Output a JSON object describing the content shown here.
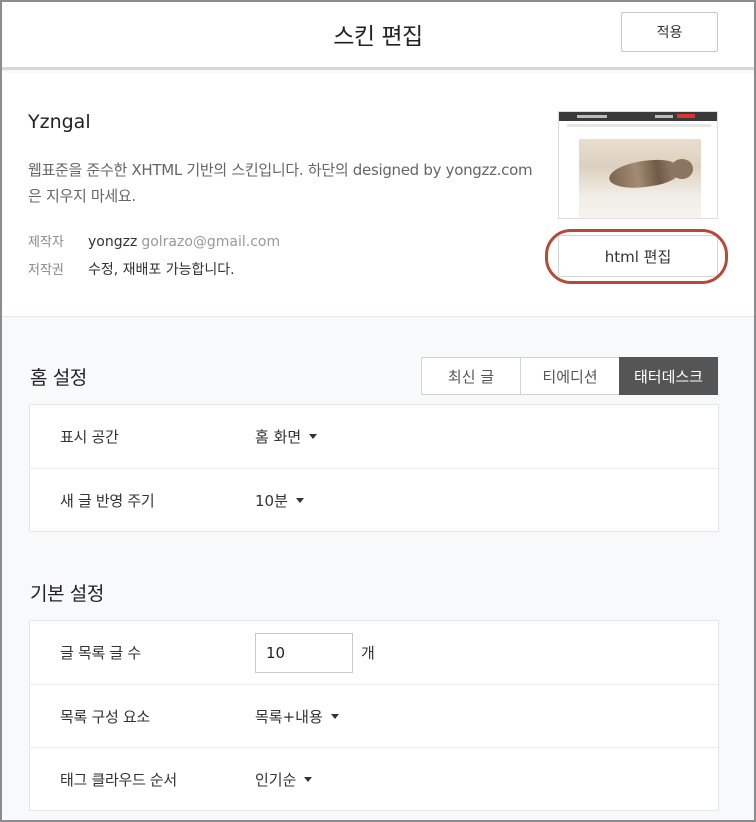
{
  "header": {
    "title": "스킨 편집",
    "apply_label": "적용"
  },
  "skin": {
    "name": "Yzngal",
    "description": "웹표준을 준수한 XHTML 기반의 스킨입니다. 하단의 designed by yongzz.com 은 지우지 마세요.",
    "author_label": "제작자",
    "author": "yongzz",
    "email": "golrazo@gmail.com",
    "copyright_label": "저작권",
    "copyright": "수정, 재배포 가능합니다.",
    "html_edit_label": "html 편집"
  },
  "home_settings": {
    "title": "홈 설정",
    "tabs": [
      {
        "label": "최신 글",
        "active": false
      },
      {
        "label": "티에디션",
        "active": false
      },
      {
        "label": "태터데스크",
        "active": true
      }
    ],
    "rows": [
      {
        "label": "표시 공간",
        "value": "홈 화면"
      },
      {
        "label": "새 글 반영 주기",
        "value": "10분"
      }
    ]
  },
  "basic_settings": {
    "title": "기본 설정",
    "post_count_label": "글 목록 글 수",
    "post_count_value": "10",
    "post_count_unit": "개",
    "list_composition_label": "목록 구성 요소",
    "list_composition_value": "목록+내용",
    "tag_cloud_label": "태그 클라우드 순서",
    "tag_cloud_value": "인기순"
  },
  "colors": {
    "highlight": "#b64a3a",
    "active_tab": "#555555"
  }
}
